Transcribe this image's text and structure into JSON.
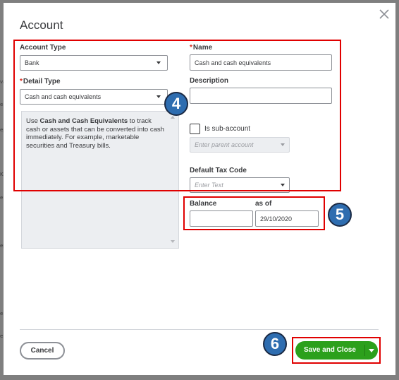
{
  "background": {
    "fragments": [
      "va",
      "e",
      "ep",
      "K",
      "e",
      "ep",
      "e",
      "e"
    ]
  },
  "dialog": {
    "title": "Account",
    "close_icon": "close-icon"
  },
  "form": {
    "account_type": {
      "label": "Account Type",
      "value": "Bank"
    },
    "detail_type": {
      "required_mark": "*",
      "label": "Detail Type",
      "value": "Cash and cash equivalents"
    },
    "name": {
      "required_mark": "*",
      "label": "Name",
      "value": "Cash and cash equivalents"
    },
    "description": {
      "label": "Description",
      "value": ""
    },
    "help": {
      "prefix": "Use ",
      "bold": "Cash and Cash Equivalents",
      "suffix": " to track cash or assets that can be converted into cash immediately. For example, marketable securities and Treasury bills."
    },
    "sub_account": {
      "label": "Is sub-account",
      "checked": false
    },
    "parent_account": {
      "placeholder": "Enter parent account"
    },
    "default_tax_code": {
      "label": "Default Tax Code",
      "placeholder": "Enter Text"
    },
    "balance": {
      "label": "Balance",
      "value": ""
    },
    "as_of": {
      "label": "as of",
      "value": "29/10/2020"
    }
  },
  "footer": {
    "cancel_label": "Cancel",
    "save_label": "Save and Close"
  },
  "annotations": {
    "badge_4": "4",
    "badge_5": "5",
    "badge_6": "6",
    "highlight_color": "#e00000",
    "badge_color": "#2e6db0"
  },
  "colors": {
    "primary_green": "#2ca01c",
    "required_red": "#d52b1e"
  }
}
